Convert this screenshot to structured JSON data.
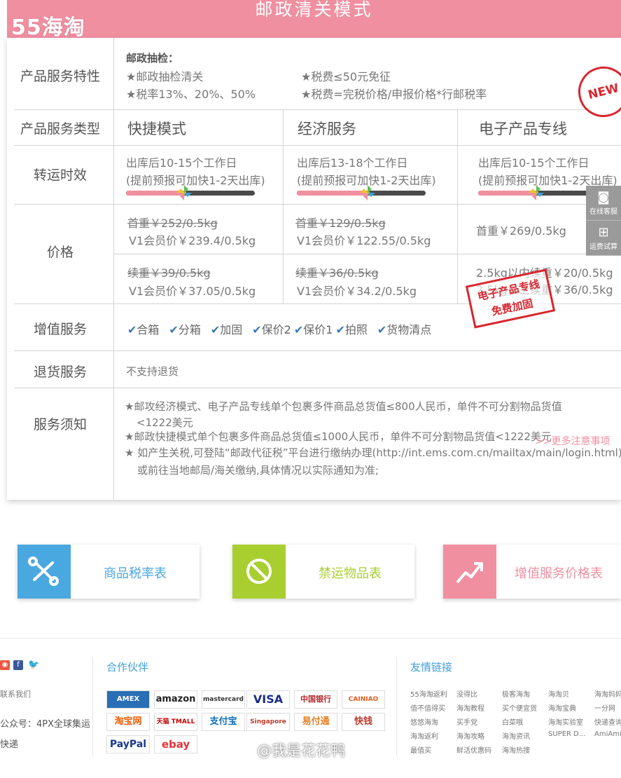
{
  "header": {
    "title": "邮政清关模式",
    "logo": "55海淘"
  },
  "table": {
    "rows": {
      "features": "产品服务特性",
      "types": "产品服务类型",
      "transit": "转运时效",
      "price": "价格",
      "value_added": "增值服务",
      "returns": "退货服务",
      "notice": "服务须知"
    },
    "features": {
      "heading": "邮政抽检：",
      "left1": "★邮政抽检清关",
      "left2": "★税率13%、20%、50%",
      "right1": "★税费≤50元免征",
      "right2": "★税费=完税价格/申报价格*行邮税率"
    },
    "columns": [
      "快捷模式",
      "经济服务",
      "电子产品专线"
    ],
    "new_badge": "NEW",
    "transit": [
      {
        "line1": "出库后10-15个工作日",
        "line2": "(提前预报可加快1-2天出库)",
        "progress": 0.45
      },
      {
        "line1": "出库后13-18个工作日",
        "line2": "(提前预报可加快1-2天出库)",
        "progress": 0.55
      },
      {
        "line1": "出库后10-15个工作日",
        "line2": "(提前预报可加快1-2天出库)",
        "progress": 0.45
      }
    ],
    "first_weight": [
      {
        "original": "首重￥252/0.5kg",
        "member": "V1会员价￥239.4/0.5kg"
      },
      {
        "original": "首重￥129/0.5kg",
        "member": "V1会员价￥122.55/0.5kg"
      },
      {
        "price": "首重￥269/0.5kg"
      }
    ],
    "extra_weight": [
      {
        "original": "续重￥39/0.5kg",
        "member": "V1会员价￥37.05/0.5kg"
      },
      {
        "original": "续重￥36/0.5kg",
        "member": "V1会员价￥34.2/0.5kg"
      },
      {
        "line1": "2.5kg以内续重￥20/0.5kg",
        "line2": "2.5kg以上续重￥36/0.5kg"
      }
    ],
    "services": [
      "合箱",
      "分箱",
      "加固",
      "保价2",
      "保价1",
      "拍照",
      "货物清点"
    ],
    "stamp": {
      "line1": "电子产品专线",
      "line2": "免费加固"
    },
    "returns_text": "不支持退货",
    "notices": {
      "n1a": "★邮攻经济模式、电子产品专线单个包裹多件商品总货值≤800人民币，单件不可分割物品货值",
      "n1b": "<1222美元",
      "n2": "★邮政快捷模式单个包裹多件商品总货值≤1000人民币，单件不可分割物品货值<1222美元",
      "n3a": "★ 如产生关税,可登陆“邮政代征税”平台进行缴纳办理(http://int.ems.com.cn/mailtax/main/login.html)",
      "n3b": "或前往当地邮局/海关缴纳,具体情况以实际通知为准;"
    },
    "more_link": ">>更多注意事项"
  },
  "side_tools": {
    "service": "在线客服",
    "calc": "运费试算"
  },
  "links": [
    {
      "label": "商品税率表",
      "color": "#4aa8e0"
    },
    {
      "label": "禁运物品表",
      "color": "#a8cf2f"
    },
    {
      "label": "增值服务价格表",
      "color": "#f08fa0"
    }
  ],
  "footer": {
    "contact": "联系我们",
    "wechat": "公众号：4PX全球集运",
    "express": "快递",
    "partners_title": "合作伙伴",
    "partners": [
      "AMEX",
      "amazon",
      "mastercard",
      "VISA",
      "中国银行",
      "CAINIAO",
      "淘宝网",
      "天猫 TMALL",
      "支付宝",
      "Singapore POST",
      "易付通",
      "快钱",
      "PayPal",
      "ebay"
    ],
    "friends_title": "友情链接",
    "friends": [
      [
        "55海淘返利",
        "没得比",
        "极客海淘",
        "海淘贝",
        "海淘妈妈"
      ],
      [
        "值不值得买",
        "海淘教程",
        "买个便宜货",
        "海淘宝典",
        "一分网"
      ],
      [
        "悠悠海淘",
        "买手党",
        "白菜哦",
        "海淘实验室",
        "快递查询"
      ],
      [
        "海淘返利",
        "海淘攻略",
        "海淘资讯",
        "SUPER D...",
        "AmiAmi"
      ],
      [
        "最值买",
        "鲜活优惠码",
        "海淘热搜",
        "",
        ""
      ]
    ]
  },
  "watermark": "@我是花花鸭"
}
